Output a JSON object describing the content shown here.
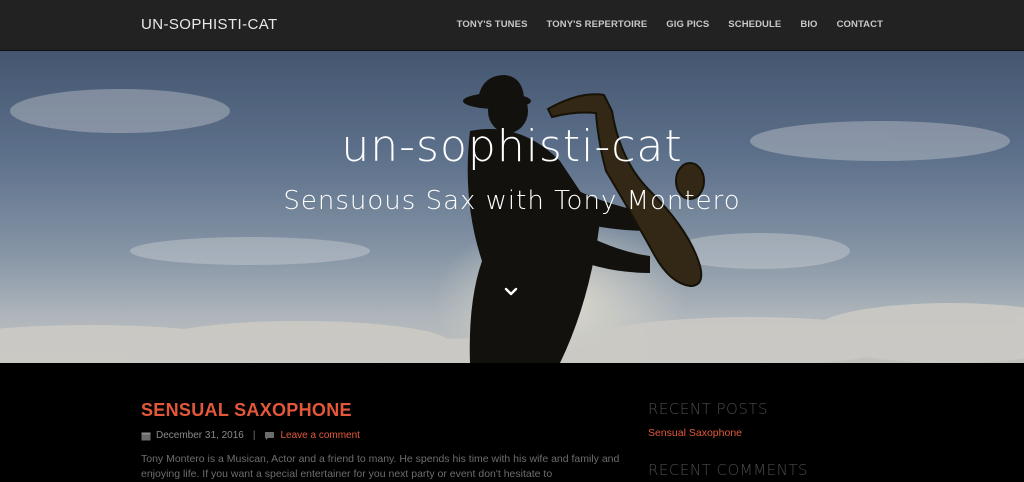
{
  "navbar": {
    "brand": "UN-SOPHISTI-CAT",
    "items": [
      {
        "label": "TONY'S TUNES"
      },
      {
        "label": "TONY'S REPERTOIRE"
      },
      {
        "label": "GIG PICS"
      },
      {
        "label": "SCHEDULE"
      },
      {
        "label": "BIO"
      },
      {
        "label": "CONTACT"
      }
    ]
  },
  "hero": {
    "title": "un-sophisti-cat",
    "subtitle": "Sensuous Sax with Tony Montero",
    "scroll_icon": "chevron-down-icon"
  },
  "post": {
    "title": "SENSUAL SAXOPHONE",
    "date": "December 31, 2016",
    "date_icon": "calendar-icon",
    "comment_icon": "comment-icon",
    "comment_link": "Leave a comment",
    "excerpt": "Tony Montero is a Musican, Actor and a friend to many. He spends his time with his wife and family and enjoying life. If you want a special entertainer for you next party or event don't hesitate to"
  },
  "sidebar": {
    "recent_posts_title": "RECENT POSTS",
    "recent_posts": [
      "Sensual Saxophone"
    ],
    "recent_comments_title": "RECENT COMMENTS"
  },
  "colors": {
    "accent": "#e4583a",
    "navbar_bg": "#222222",
    "content_bg": "#000000"
  }
}
